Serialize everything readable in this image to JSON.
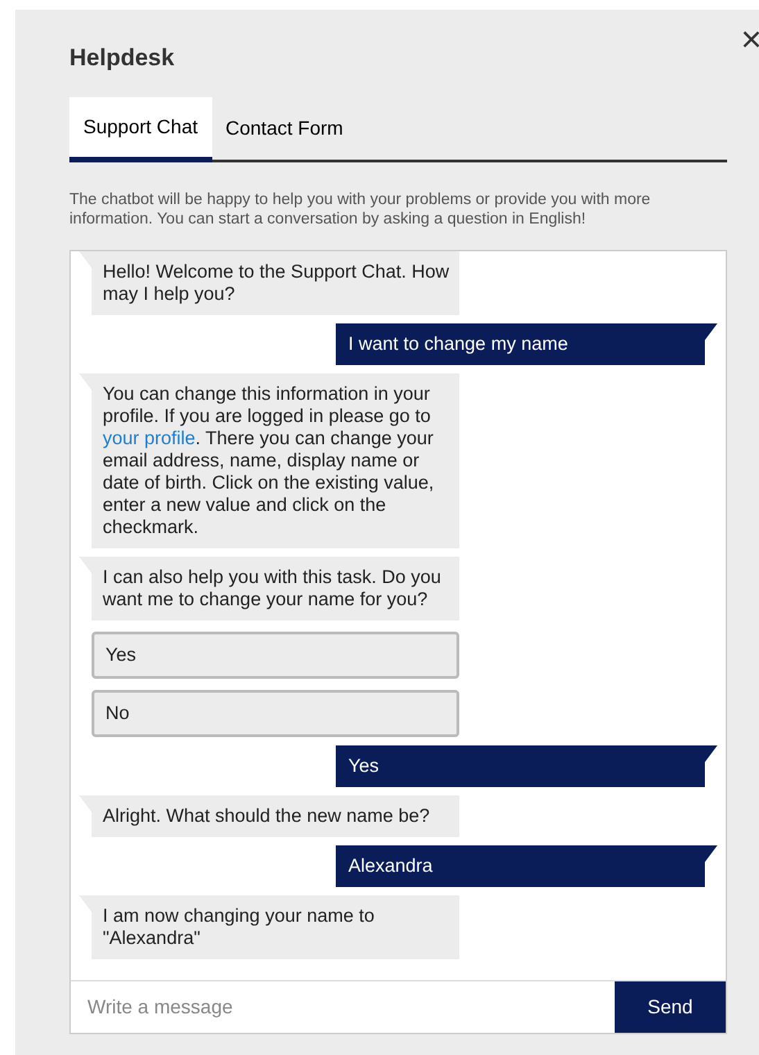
{
  "dialog": {
    "title": "Helpdesk",
    "close": "×"
  },
  "tabs": [
    {
      "label": "Support Chat",
      "selected": true
    },
    {
      "label": "Contact Form",
      "selected": false
    }
  ],
  "intro": "The chatbot will be happy to help you with your problems or provide you with more information. You can start a conversation by asking a question in English!",
  "messages": [
    {
      "kind": "bot",
      "parts": [
        {
          "kind": "text",
          "text": "Hello! Welcome to the Support Chat. How may I help you?"
        }
      ]
    },
    {
      "kind": "user",
      "parts": [
        {
          "kind": "text",
          "text": "I want to change my name"
        }
      ]
    },
    {
      "kind": "bot",
      "parts": [
        {
          "kind": "text",
          "text": "You can change this information in your profile. If you are logged in please go to "
        },
        {
          "kind": "link",
          "text": "your profile"
        },
        {
          "kind": "text",
          "text": ". There you can change your email address, name, display name or date of birth. Click on the existing value, enter a new value and click on the checkmark."
        }
      ]
    },
    {
      "kind": "bot",
      "parts": [
        {
          "kind": "text",
          "text": "I can also help you with this task. Do you want me to change your name for you?"
        }
      ]
    },
    {
      "kind": "option",
      "parts": [
        {
          "kind": "text",
          "text": "Yes"
        }
      ]
    },
    {
      "kind": "option",
      "parts": [
        {
          "kind": "text",
          "text": "No"
        }
      ]
    },
    {
      "kind": "user",
      "parts": [
        {
          "kind": "text",
          "text": "Yes"
        }
      ]
    },
    {
      "kind": "bot",
      "parts": [
        {
          "kind": "text",
          "text": "Alright. What should the new name be?"
        }
      ]
    },
    {
      "kind": "user",
      "parts": [
        {
          "kind": "text",
          "text": "Alexandra"
        }
      ]
    },
    {
      "kind": "bot",
      "parts": [
        {
          "kind": "text",
          "text": "I am now changing your name to \"Alexandra\""
        }
      ]
    }
  ],
  "composer": {
    "placeholder": "Write a message",
    "send": "Send"
  }
}
